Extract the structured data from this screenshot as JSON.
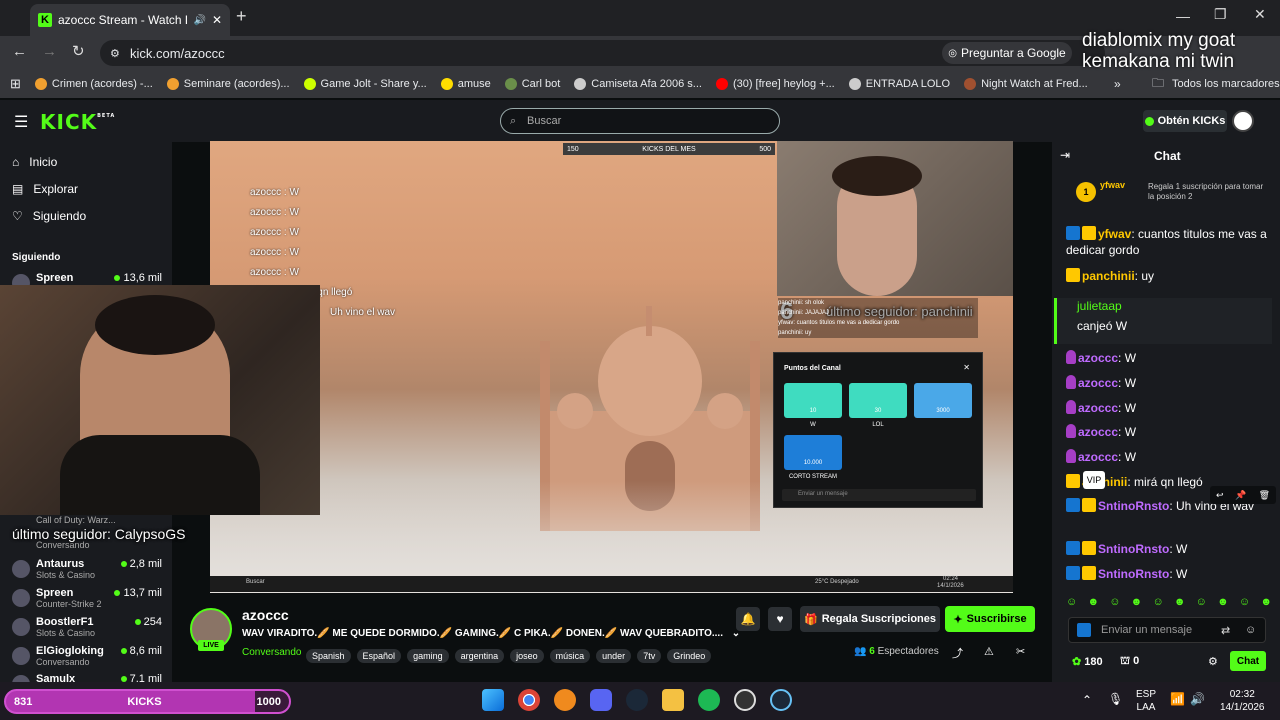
{
  "browser": {
    "tab_title": "azoccc Stream - Watch Live",
    "url": "kick.com/azoccc",
    "google_btn": "Preguntar a Google",
    "all_bookmarks": "Todos los marcadores",
    "bookmarks": [
      {
        "label": "Crimen (acordes) -...",
        "color": "#f0a030"
      },
      {
        "label": "Seminare (acordes)...",
        "color": "#f0a030"
      },
      {
        "label": "Game Jolt - Share y...",
        "color": "#ccff00"
      },
      {
        "label": "amuse",
        "color": "#ffdd00"
      },
      {
        "label": "Carl bot",
        "color": "#6a8f4a"
      },
      {
        "label": "Camiseta Afa 2006 s...",
        "color": "#cccccc"
      },
      {
        "label": "(30) [free] heylog +...",
        "color": "#ff0000"
      },
      {
        "label": "ENTRADA LOLO",
        "color": "#cccccc"
      },
      {
        "label": "Night Watch at Fred...",
        "color": "#a05030"
      }
    ]
  },
  "header": {
    "logo": "KICK",
    "beta": "BETA",
    "search_placeholder": "Buscar",
    "kicks_btn": "Obtén KICKs"
  },
  "sidebar": {
    "nav": [
      "Inicio",
      "Explorar",
      "Siguiendo"
    ],
    "section": "Siguiendo",
    "follows": [
      {
        "name": "Spreen",
        "count": "13,6 mil",
        "category": ""
      },
      {
        "name": "",
        "count": "",
        "category": "Call of Duty: Warz..."
      },
      {
        "name": "",
        "count": "",
        "category": "Conversando"
      },
      {
        "name": "Antaurus",
        "count": "2,8 mil",
        "category": "Slots & Casino"
      },
      {
        "name": "Spreen",
        "count": "13,7 mil",
        "category": "Counter-Strike 2"
      },
      {
        "name": "BoostlerF1",
        "count": "254",
        "category": "Slots & Casino"
      },
      {
        "name": "ElGiogloking",
        "count": "8,6 mil",
        "category": "Conversando"
      },
      {
        "name": "Samulx",
        "count": "7,1 mil",
        "category": ""
      }
    ]
  },
  "video": {
    "last_follower_left": "último seguidor: CalypsoGS",
    "last_follower_right": "último seguidor: panchinii",
    "big_number": "6",
    "kicks_del_mes": "KICKS DEL MES",
    "kicks_min": "150",
    "kicks_max": "500",
    "canal_points_title": "Puntos del Canal",
    "points": [
      {
        "value": "10",
        "label": "W",
        "color": "#3fdcc0"
      },
      {
        "value": "30",
        "label": "LOL",
        "color": "#3fdcc0"
      },
      {
        "value": "3000",
        "label": "",
        "color": "#4aa8e8"
      },
      {
        "value": "10.000",
        "label": "CORTO STREAM",
        "color": "#1e7ed8"
      }
    ],
    "mini_chat_input": "Enviar un mensaje",
    "mini_chat": [
      "panchinii: sh olok",
      "panchinii: JAJAJAJ",
      "yfwav: cuantos titulos me vas a dedicar gordo",
      "panchinii: uy"
    ],
    "desktop_overlay_chat": [
      "azoccc : W",
      "azoccc : W",
      "azoccc : W",
      "azoccc : W",
      "azoccc : W",
      "panchinii: mirá qn llegó",
      "Uh vino el wav"
    ],
    "inner_taskbar_search": "Buscar",
    "inner_weather": "25°C Despejado",
    "inner_time": "02:24",
    "inner_date": "14/1/2026"
  },
  "stream": {
    "channel": "azoccc",
    "live": "LIVE",
    "title": "WAV VIRADITO.🥖 ME QUEDE DORMIDO.🥖 GAMING.🥖 C PIKA.🥖 DONEN.🥖 WAV QUEBRADITO....",
    "category": "Conversando",
    "tags": [
      "Spanish",
      "Español",
      "gaming",
      "argentina",
      "joseo",
      "música",
      "under",
      "7tv",
      "Grindeo"
    ],
    "gift_btn": "Regala Suscripciones",
    "subscribe_btn": "Suscribirse",
    "viewers_count": "6",
    "viewers_label": "Espectadores"
  },
  "chat": {
    "title": "Chat",
    "pinned_user": "yfwav",
    "pinned_rank": "1",
    "pinned_text": "Regala 1 suscripción para tomar la posición 2",
    "messages": [
      {
        "user": "yfwav",
        "text": ": cuantos titulos me vas a dedicar gordo",
        "color": "#ffc800",
        "badges": [
          "mod",
          "vip"
        ]
      },
      {
        "user": "panchinii",
        "text": ": uy",
        "color": "#ffc800",
        "badges": [
          "vip"
        ]
      },
      {
        "user": "julietaap",
        "text": "canjeó W",
        "color": "#53fc18",
        "badges": []
      },
      {
        "user": "azoccc",
        "text": ": W",
        "color": "#bf6bff",
        "badges": [
          "mic"
        ]
      },
      {
        "user": "azoccc",
        "text": ": W",
        "color": "#bf6bff",
        "badges": [
          "mic"
        ]
      },
      {
        "user": "azoccc",
        "text": ": W",
        "color": "#bf6bff",
        "badges": [
          "mic"
        ]
      },
      {
        "user": "azoccc",
        "text": ": W",
        "color": "#bf6bff",
        "badges": [
          "mic"
        ]
      },
      {
        "user": "azoccc",
        "text": ": W",
        "color": "#bf6bff",
        "badges": [
          "mic"
        ]
      },
      {
        "user": "anchinii",
        "text": ": mirá qn llegó",
        "color": "#ffc800",
        "badges": [
          "vip"
        ]
      },
      {
        "user": "SntinoRnsto",
        "text": ": Uh vino el wav",
        "color": "#bf6bff",
        "badges": [
          "mod",
          "vip"
        ]
      },
      {
        "user": "SntinoRnsto",
        "text": ": W",
        "color": "#bf6bff",
        "badges": [
          "mod",
          "vip"
        ]
      },
      {
        "user": "SntinoRnsto",
        "text": ": W",
        "color": "#bf6bff",
        "badges": [
          "mod",
          "vip"
        ]
      }
    ],
    "vip_tooltip": "VIP",
    "input_placeholder": "Enviar un mensaje",
    "points": "180",
    "gifts": "0",
    "send_btn": "Chat"
  },
  "corner_text": "diablomix my goat\nkemakana mi twin",
  "taskbar": {
    "kicks_current": "831",
    "kicks_label": "KICKS",
    "kicks_goal": "1000",
    "lang1": "ESP",
    "lang2": "LAA",
    "time": "02:32",
    "date": "14/1/2026"
  },
  "colors": {
    "kick_green": "#53fc18",
    "bg": "#0b0e0f",
    "panel": "#191b1f"
  }
}
